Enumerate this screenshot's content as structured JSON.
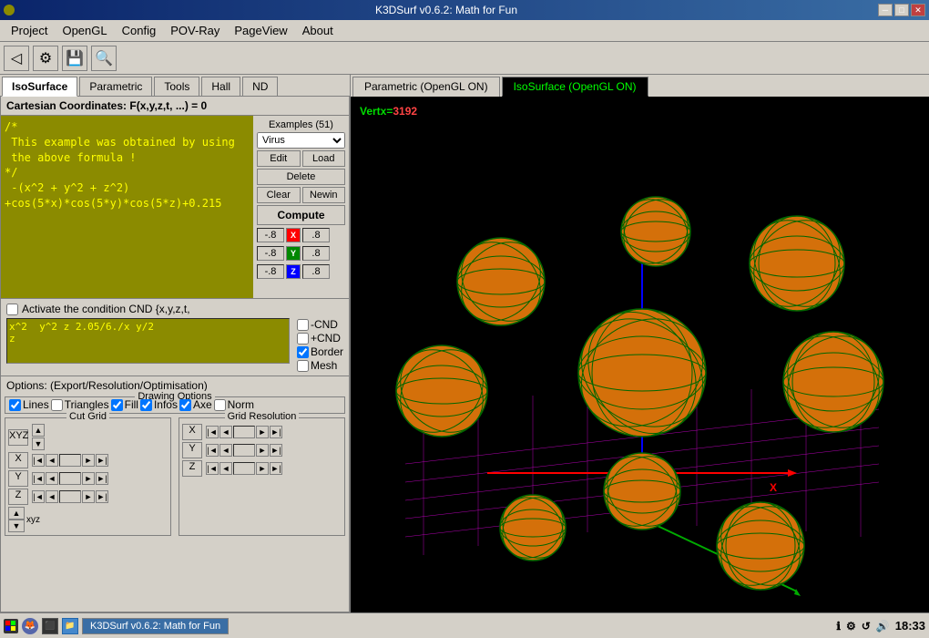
{
  "titlebar": {
    "title": "K3DSurf v0.6.2: Math for Fun",
    "min_btn": "─",
    "max_btn": "□",
    "close_btn": "✕"
  },
  "menubar": {
    "items": [
      "Project",
      "OpenGL",
      "Config",
      "POV-Ray",
      "PageView",
      "About"
    ]
  },
  "toolbar": {
    "icons": [
      "◁",
      "⚙",
      "💾",
      "🔍"
    ]
  },
  "left_tabs": {
    "items": [
      "IsoSurface",
      "Parametric",
      "Tools",
      "Hall",
      "ND"
    ],
    "active": "IsoSurface"
  },
  "formula_header": "Cartesian Coordinates: F(x,y,z,t, ...) = 0",
  "formula_text": "/*\n This example was obtained by using\n the above formula !\n*/\n -(x^2 + y^2 + z^2)\n+cos(5*x)*cos(5*y)*cos(5*z)+0.215",
  "examples": {
    "label": "Examples (51)",
    "current": "Virus"
  },
  "buttons": {
    "edit": "Edit",
    "load": "Load",
    "delete": "Delete",
    "clear": "Clear",
    "newin": "Newin",
    "compute": "Compute"
  },
  "axes": {
    "x": {
      "min": "-.8",
      "max": ".8",
      "color": "red",
      "label": "X"
    },
    "y": {
      "min": "-.8",
      "max": ".8",
      "color": "green",
      "label": "Y"
    },
    "z": {
      "min": "-.8",
      "max": ".8",
      "color": "blue",
      "label": "Z"
    }
  },
  "cnd": {
    "activate_label": "Activate the condition CND {x,y,z,t,",
    "text": "x^2  y^2 z 2.05/6./x y/2\nz</",
    "options": [
      "-CND",
      "+CND",
      "Border",
      "Mesh"
    ]
  },
  "options_label": "Options: (Export/Resolution/Optimisation)",
  "drawing_options": {
    "title": "Drawing Options",
    "checks": [
      {
        "label": "Lines",
        "checked": true
      },
      {
        "label": "Triangles",
        "checked": false
      },
      {
        "label": "Fill",
        "checked": true
      },
      {
        "label": "Infos",
        "checked": true
      },
      {
        "label": "Axe",
        "checked": true
      },
      {
        "label": "Norm",
        "checked": false
      }
    ]
  },
  "cut_grid": {
    "title": "Cut Grid",
    "xyz_btn": "XYZ",
    "axes": [
      "X",
      "Y",
      "Z"
    ]
  },
  "grid_resolution": {
    "title": "Grid Resolution",
    "axes": [
      "X",
      "Y",
      "Z"
    ]
  },
  "xyz_label": "xyz",
  "view_tabs": {
    "items": [
      "Parametric (OpenGL ON)",
      "IsoSurface (OpenGL ON)"
    ],
    "active": "IsoSurface (OpenGL ON)"
  },
  "vertex_info": "Vertx= 3192",
  "statusbar": {
    "app_label": "K3DSurf v0.6.2: Math for Fun",
    "icons": [
      "ℹ",
      "⚙",
      "↺",
      "🔊"
    ],
    "time": "18:33"
  }
}
